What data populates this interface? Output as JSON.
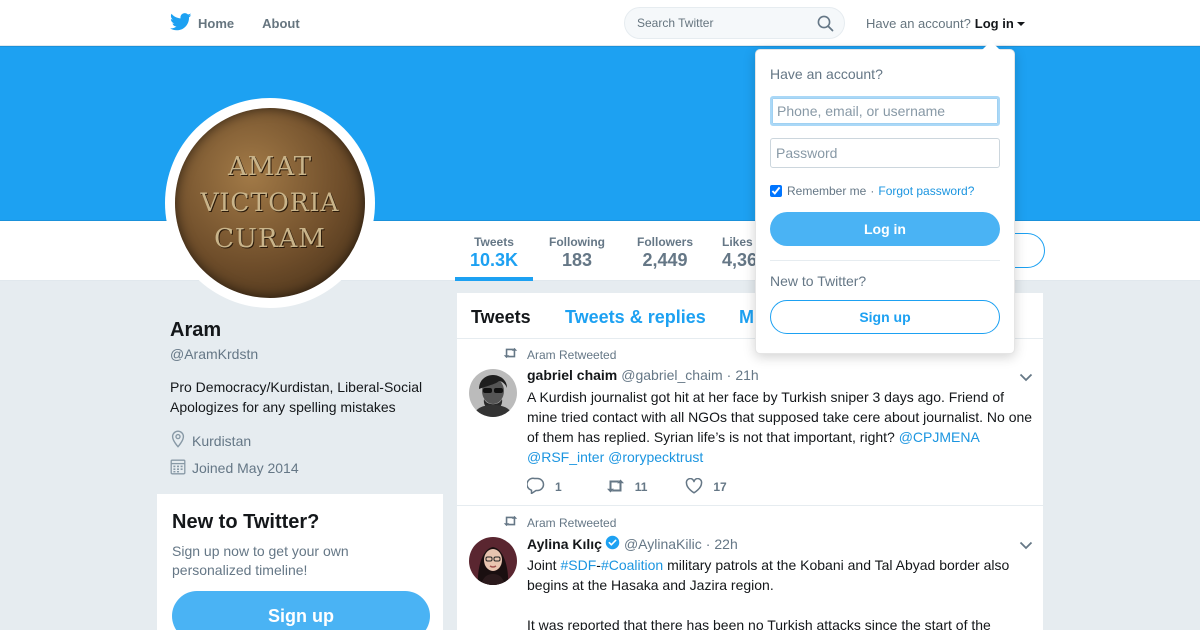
{
  "nav": {
    "home_label": "Home",
    "about_label": "About",
    "search_placeholder": "Search Twitter",
    "account_prompt": "Have an account?",
    "login_label": "Log in"
  },
  "profile": {
    "name": "Aram",
    "handle": "@AramKrdstn",
    "bio_line1": "Pro Democracy/Kurdistan, Liberal-Social",
    "bio_line2": "Apologizes for any spelling mistakes",
    "location": "Kurdistan",
    "joined": "Joined May 2014",
    "avatar_text": [
      "AMAT",
      "VICTORIA",
      "CURAM"
    ]
  },
  "stats": [
    {
      "label": "Tweets",
      "value": "10.3K"
    },
    {
      "label": "Following",
      "value": "183"
    },
    {
      "label": "Followers",
      "value": "2,449"
    },
    {
      "label": "Likes",
      "value": "4,36"
    }
  ],
  "signup_card": {
    "title": "New to Twitter?",
    "text": "Sign up now to get your own personalized timeline!",
    "button": "Sign up"
  },
  "timeline": {
    "tabs": [
      "Tweets",
      "Tweets & replies",
      "M"
    ],
    "tweets": [
      {
        "retweet_label": "Aram Retweeted",
        "name": "gabriel chaim",
        "handle": "@gabriel_chaim",
        "time": "21h",
        "text": "A Kurdish journalist got hit at her face by Turkish sniper 3 days ago. Friend of mine tried contact with all NGOs that supposed take cere about journalist. No one of them has replied. Syrian life’s is not that important, right?",
        "mention1": "@CPJMENA",
        "mention2": "@RSF_inter",
        "mention3": "@rorypecktrust",
        "replies": "1",
        "retweets": "11",
        "likes": "17"
      },
      {
        "retweet_label": "Aram Retweeted",
        "name": "Aylina Kılıç",
        "handle": "@AylinaKilic",
        "time": "22h",
        "text_pre": "Joint",
        "hashtag1": "#SDF",
        "sep": "-",
        "hashtag2": "#Coalition",
        "text_post": "military patrols at the Kobani and Tal Abyad border also begins at the Hasaka and Jazira region.",
        "text2": "It was reported that there has been no Turkish attacks since the start of the"
      }
    ]
  },
  "login_dropdown": {
    "title": "Have an account?",
    "username_placeholder": "Phone, email, or username",
    "password_placeholder": "Password",
    "remember": "Remember me",
    "separator": "·",
    "forgot": "Forgot password?",
    "login_button": "Log in",
    "new_prompt": "New to Twitter?",
    "signup_button": "Sign up"
  },
  "colors": {
    "brand": "#1da1f2",
    "button": "#4ab3f4",
    "link": "#1b95e0"
  }
}
